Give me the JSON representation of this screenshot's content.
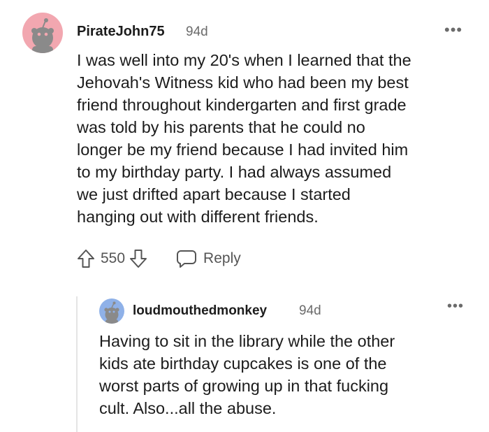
{
  "comment": {
    "username": "PirateJohn75",
    "age": "94d",
    "more_label": "•••",
    "avatar_color": "#f2a7b0",
    "body_lines": [
      "I was well into my 20's when I learned that the",
      "Jehovah's Witness kid who had been my best",
      "friend throughout kindergarten and first grade",
      "was told by his parents that he could no",
      "longer be my friend because I had invited him",
      "to my birthday party. I had always assumed",
      "we just drifted apart because I started",
      "hanging out with different friends."
    ],
    "vote_count": "550",
    "reply_label": "Reply"
  },
  "reply": {
    "username": "loudmouthedmonkey",
    "age": "94d",
    "more_label": "•••",
    "avatar_color": "#8fb1e8",
    "body_lines": [
      "Having to sit in the library while the other",
      "kids ate birthday cupcakes is one of the",
      "worst parts of growing up in that fucking",
      "cult. Also...all the abuse."
    ]
  },
  "icons": {
    "upvote": "upvote-arrow-icon",
    "downvote": "downvote-arrow-icon",
    "reply": "speech-bubble-icon",
    "more": "more-options-icon",
    "avatar": "snoo-avatar-icon"
  }
}
